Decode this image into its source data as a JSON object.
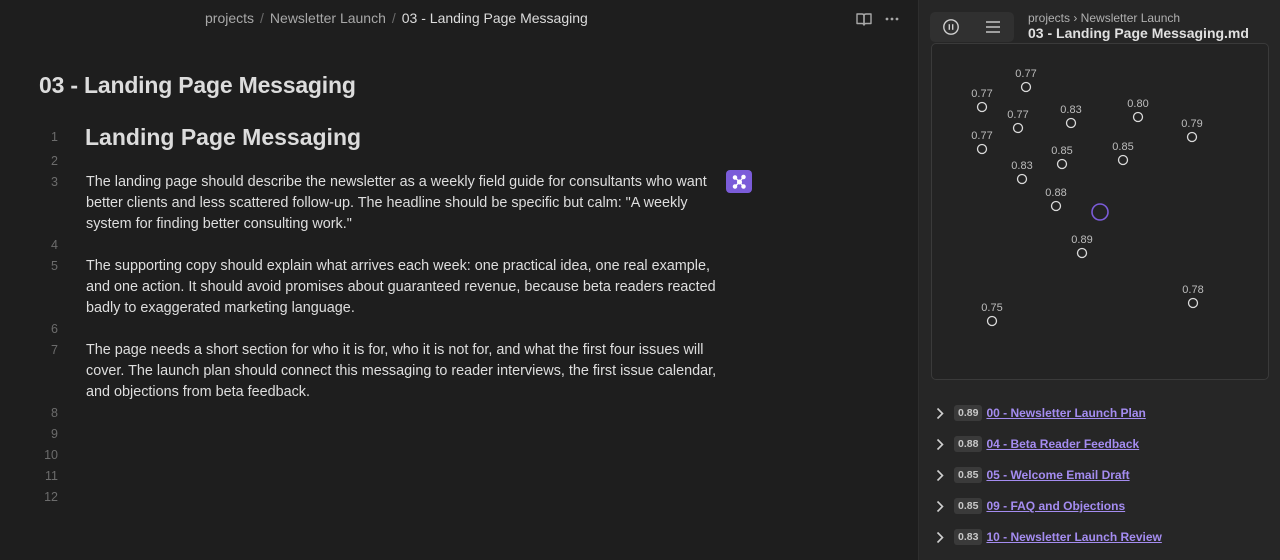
{
  "editor": {
    "breadcrumb": {
      "part1": "projects",
      "part2": "Newsletter Launch",
      "current": "03 - Landing Page Messaging"
    },
    "note_title": "03 - Landing Page Messaging",
    "line_numbers": [
      "1",
      "2",
      "3",
      "4",
      "5",
      "6",
      "7",
      "8",
      "9",
      "10",
      "11",
      "12"
    ],
    "heading": "Landing Page Messaging",
    "paragraphs": {
      "p3": [
        "The landing page should describe the newsletter as a weekly field guide for consultants who want",
        "better clients and less scattered follow-up. The headline should be specific but calm: \"A weekly",
        "system for finding better consulting work.\""
      ],
      "p5": [
        "The supporting copy should explain what arrives each week: one practical idea, one real example,",
        "and one action. It should avoid promises about guaranteed revenue, because beta readers reacted",
        "badly to exaggerated marketing language."
      ],
      "p7": [
        "The page needs a short section for who it is for, who it is not for, and what the first four issues will",
        "cover. The launch plan should connect this messaging to reader interviews, the first issue calendar,",
        "and objections from beta feedback."
      ]
    },
    "icons": {
      "reading": "book-open-icon",
      "more": "more-horizontal-icon",
      "badge": "graph-network-icon"
    }
  },
  "sidebar": {
    "path": "projects › Newsletter Launch",
    "title": "03 - Landing Page Messaging.md",
    "icons": {
      "pause": "pause-circle-icon",
      "list": "list-icon",
      "chevron": "chevron-right-icon"
    },
    "graph_labels": [
      "0.77",
      "0.77",
      "0.77",
      "0.77",
      "0.83",
      "0.80",
      "0.79",
      "0.85",
      "0.85",
      "0.83",
      "0.88",
      "0.89",
      "0.75",
      "0.78"
    ],
    "results": [
      {
        "score": "0.89",
        "title": "00 - Newsletter Launch Plan"
      },
      {
        "score": "0.88",
        "title": "04 - Beta Reader Feedback"
      },
      {
        "score": "0.85",
        "title": "05 - Welcome Email Draft"
      },
      {
        "score": "0.85",
        "title": "09 - FAQ and Objections"
      },
      {
        "score": "0.83",
        "title": "10 - Newsletter Launch Review"
      }
    ],
    "colors": {
      "accent": "#7b5cd9",
      "link": "#a48cf0",
      "focus_node": "#7b5cd9"
    }
  }
}
